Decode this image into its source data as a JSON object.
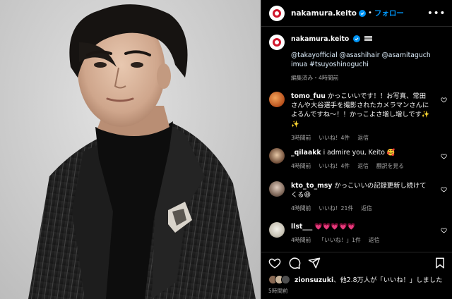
{
  "header": {
    "username": "nakamura.keito",
    "separator": "•",
    "follow_label": "フォロー",
    "more_icon": "more-horizontal-icon"
  },
  "caption": {
    "username": "nakamura.keito",
    "flag_icon": "flag-icon",
    "tags": "@takayofficial @asashihair @asamitaguchimua #tsuyoshinoguchi",
    "meta": "編集済み・4時間前"
  },
  "comments": [
    {
      "username": "tomo_fuu",
      "text": "かっこいいです！！お写真、常田さんや大谷選手を撮影されたカメラマンさんによるんですね〜！！かっこよさ増し増しです✨✨",
      "time": "3時間前",
      "likes": "いいね！4件",
      "reply": "返信",
      "translate": ""
    },
    {
      "username": "_qilaakk",
      "text": "i admire you, Keito 🥰",
      "time": "4時間前",
      "likes": "いいね！4件",
      "reply": "返信",
      "translate": "翻訳を見る"
    },
    {
      "username": "kto_to_msy",
      "text": "かっこいいの記録更新し続けてくる😆",
      "time": "4時間前",
      "likes": "いいね！21件",
      "reply": "返信",
      "translate": ""
    },
    {
      "username": "llst___",
      "text": "💗💗💗💗💗",
      "time": "4時間前",
      "likes": "「いいね！」1件",
      "reply": "返信",
      "translate": ""
    }
  ],
  "actions": {
    "like_icon": "heart-icon",
    "comment_icon": "comment-icon",
    "share_icon": "share-icon",
    "save_icon": "bookmark-icon"
  },
  "likes": {
    "user": "zionsuzuki",
    "rest": "、他2.8万人が「いいね！」しました"
  },
  "posted_ago": "5時間前",
  "colors": {
    "accent": "#0095f6",
    "background": "#000000",
    "muted_text": "#a8a8a8",
    "link_text": "#e0f1ff"
  }
}
